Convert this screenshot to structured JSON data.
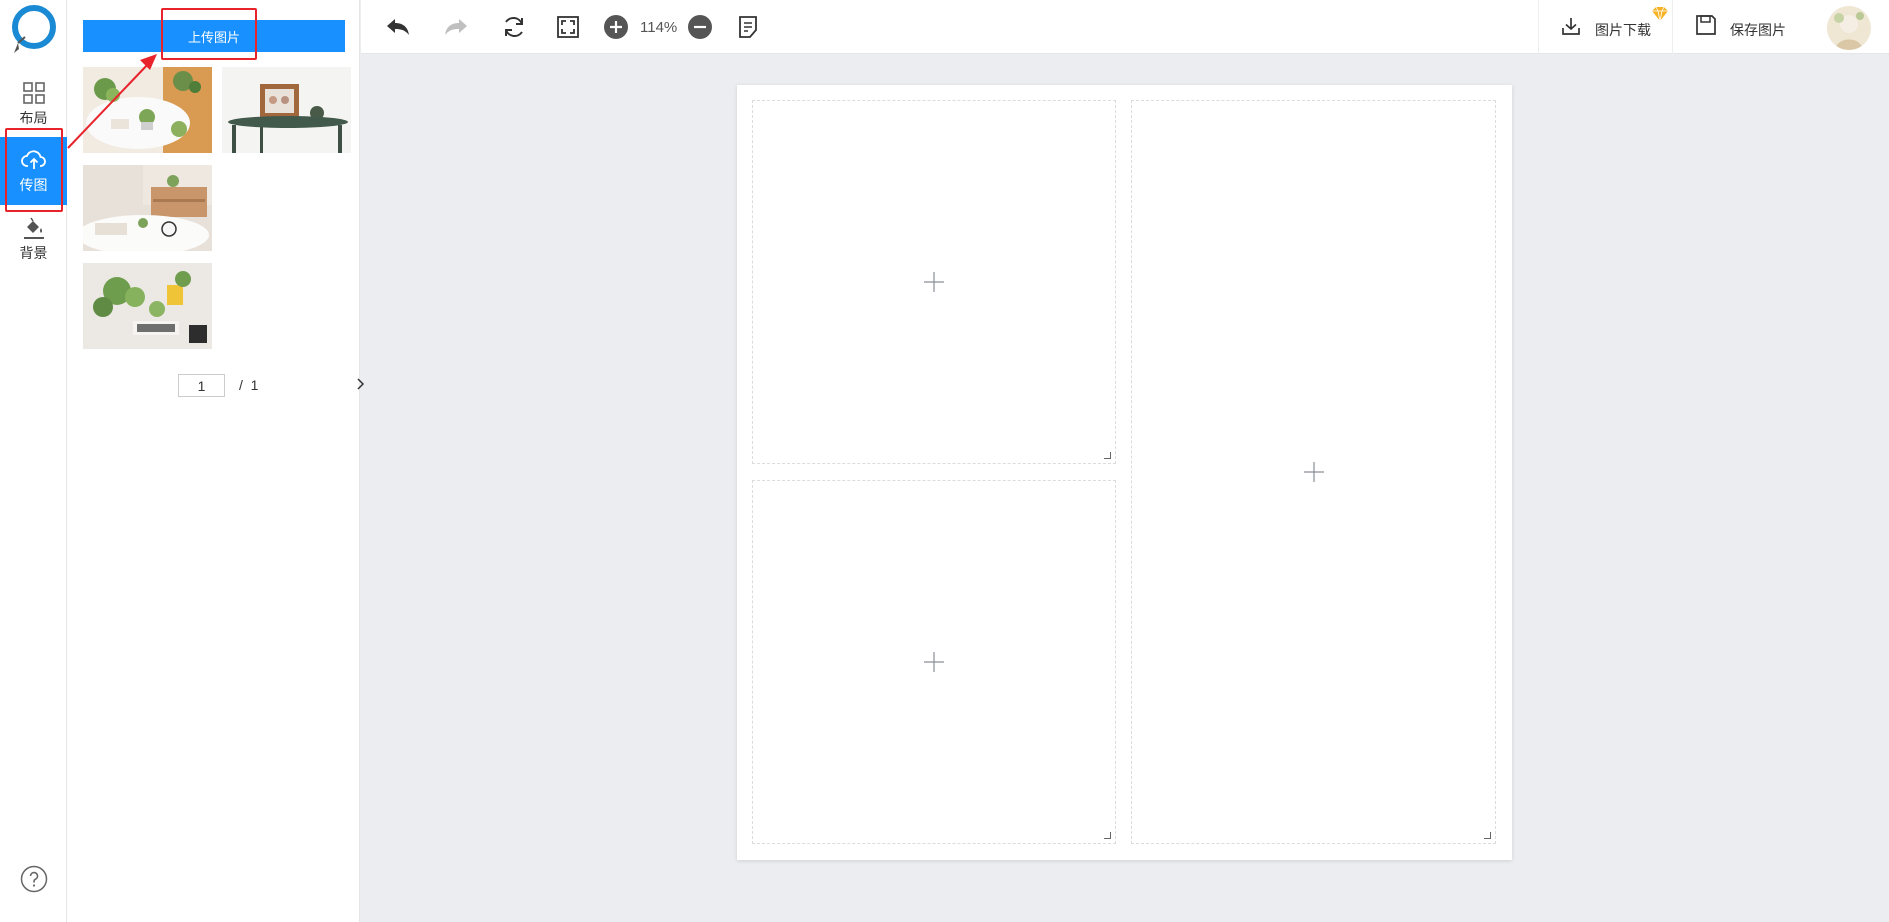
{
  "sidebar": {
    "items": [
      {
        "label": "布局",
        "icon": "layout-grid-icon"
      },
      {
        "label": "传图",
        "icon": "cloud-upload-icon",
        "active": true
      },
      {
        "label": "背景",
        "icon": "paint-bucket-icon"
      }
    ],
    "help_icon": "help-icon"
  },
  "panel": {
    "upload_label": "上传图片",
    "thumbnails": [
      "photo-plants-desk",
      "photo-frame-table",
      "photo-bedroom-clock",
      "photo-plants-love"
    ],
    "pagination": {
      "current": "1",
      "separator": "/",
      "total": "1"
    }
  },
  "toolbar": {
    "zoom": "114%",
    "download_label": "图片下载",
    "save_label": "保存图片",
    "icons": [
      "undo-icon",
      "redo-icon",
      "refresh-icon",
      "fit-screen-icon",
      "zoom-in-icon",
      "zoom-out-icon",
      "notes-icon",
      "download-icon",
      "vip-diamond-icon",
      "save-icon"
    ]
  },
  "canvas": {
    "cells": [
      "top-left",
      "bottom-left",
      "right"
    ]
  },
  "colors": {
    "accent": "#1890ff",
    "annotation": "#e8232b",
    "workspace_bg": "#ebedf0",
    "vip": "#f5b325"
  }
}
